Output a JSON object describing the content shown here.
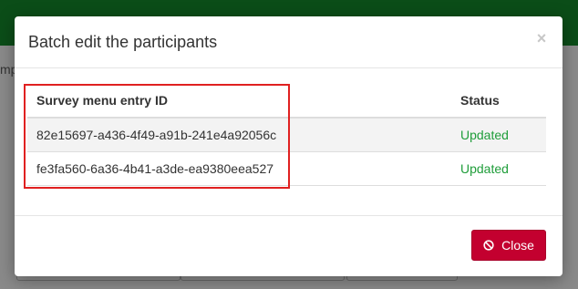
{
  "background": {
    "left_fragment": "mp"
  },
  "modal": {
    "title": "Batch edit the participants",
    "close_symbol": "×",
    "table": {
      "columns": [
        "Survey menu entry ID",
        "Status"
      ],
      "rows": [
        {
          "id": "82e15697-a436-4f49-a91b-241e4a92056c",
          "status": "Updated"
        },
        {
          "id": "fe3fa560-6a36-4b41-a3de-ea9380eea527",
          "status": "Updated"
        }
      ]
    },
    "footer": {
      "close_label": "Close",
      "close_icon": "ban-icon"
    }
  },
  "colors": {
    "brand_green": "#0b4d18",
    "status_updated": "#1f9d3a",
    "danger_button": "#c3002f",
    "highlight": "#e02020"
  }
}
